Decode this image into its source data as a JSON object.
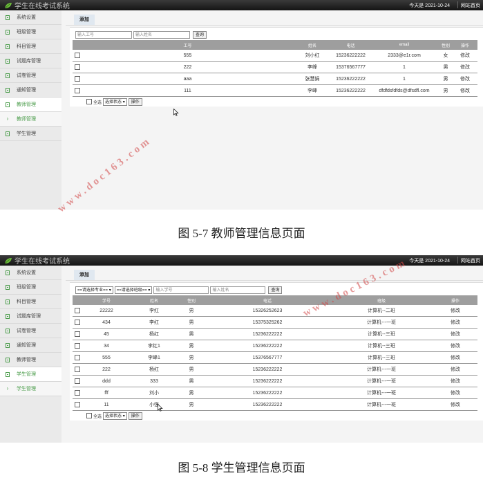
{
  "app_title": "学生在线考试系统",
  "date_text": "今天是 2021-10-24",
  "home_link": "网站首页",
  "tab_add": "添加",
  "colors": {
    "accent": "#4a9c4a",
    "header_bg": "#9e9e9e",
    "topbar": "#1e1e1e"
  },
  "screen1": {
    "sidebar": [
      {
        "label": "系统设置",
        "icon": "document-icon"
      },
      {
        "label": "班级管理",
        "icon": "document-icon"
      },
      {
        "label": "科目管理",
        "icon": "document-icon"
      },
      {
        "label": "试题库管理",
        "icon": "document-icon"
      },
      {
        "label": "试卷管理",
        "icon": "document-icon"
      },
      {
        "label": "通知管理",
        "icon": "document-icon"
      },
      {
        "label": "教师管理",
        "icon": "document-icon"
      },
      {
        "label": "教师管理",
        "icon": "chevron-right-icon"
      },
      {
        "label": "学生管理",
        "icon": "document-icon"
      }
    ],
    "search": {
      "id_placeholder": "输入工号",
      "name_placeholder": "输入姓名",
      "button": "查询"
    },
    "headers": [
      "",
      "工号",
      "姓名",
      "电话",
      "email",
      "性别",
      "操作"
    ],
    "rows": [
      {
        "id": "555",
        "name": "刘小红",
        "phone": "15236222222",
        "email": "2333@e1r.com",
        "gender": "女",
        "action": "修改"
      },
      {
        "id": "222",
        "name": "李峰",
        "phone": "15376567777",
        "email": "1",
        "gender": "男",
        "action": "修改"
      },
      {
        "id": "aaa",
        "name": "张慧娟",
        "phone": "15236222222",
        "email": "1",
        "gender": "男",
        "action": "修改"
      },
      {
        "id": "111",
        "name": "李峰",
        "phone": "15236222222",
        "email": "dfdfdsfdfds@dfsdfl.com",
        "gender": "男",
        "action": "修改"
      }
    ],
    "footer": {
      "select_all": "全选",
      "status_select": "选择状态",
      "operate": "操作"
    }
  },
  "caption1": "图 5-7 教师管理信息页面",
  "screen2": {
    "sidebar": [
      {
        "label": "系统设置",
        "icon": "document-icon"
      },
      {
        "label": "班级管理",
        "icon": "document-icon"
      },
      {
        "label": "科目管理",
        "icon": "document-icon"
      },
      {
        "label": "试题库管理",
        "icon": "document-icon"
      },
      {
        "label": "试卷管理",
        "icon": "document-icon"
      },
      {
        "label": "通知管理",
        "icon": "document-icon"
      },
      {
        "label": "教师管理",
        "icon": "document-icon"
      },
      {
        "label": "学生管理",
        "icon": "document-icon"
      },
      {
        "label": "学生管理",
        "icon": "chevron-right-icon"
      }
    ],
    "search": {
      "major_select": "==请选择专业==",
      "class_select": "==请选择班级==",
      "id_placeholder": "输入学号",
      "name_placeholder": "输入姓名",
      "button": "查询"
    },
    "headers": [
      "",
      "学号",
      "姓名",
      "性别",
      "电话",
      "班级",
      "操作"
    ],
    "rows": [
      {
        "id": "22222",
        "name": "李红",
        "gender": "男",
        "phone": "15326252623",
        "class": "计算机--二班",
        "action": "修改"
      },
      {
        "id": "434",
        "name": "李红",
        "gender": "男",
        "phone": "15375325262",
        "class": "计算机---一班",
        "action": "修改"
      },
      {
        "id": "45",
        "name": "杨红",
        "gender": "男",
        "phone": "15236222222",
        "class": "计算机--三班",
        "action": "修改"
      },
      {
        "id": "34",
        "name": "李红1",
        "gender": "男",
        "phone": "15236222222",
        "class": "计算机--三班",
        "action": "修改"
      },
      {
        "id": "555",
        "name": "李峰1",
        "gender": "男",
        "phone": "15376567777",
        "class": "计算机--三班",
        "action": "修改"
      },
      {
        "id": "222",
        "name": "杨红",
        "gender": "男",
        "phone": "15236222222",
        "class": "计算机---一班",
        "action": "修改"
      },
      {
        "id": "ddd",
        "name": "333",
        "gender": "男",
        "phone": "15236222222",
        "class": "计算机---一班",
        "action": "修改"
      },
      {
        "id": "fff",
        "name": "刘小",
        "gender": "男",
        "phone": "15236222222",
        "class": "计算机---一班",
        "action": "修改"
      },
      {
        "id": "11",
        "name": "小强",
        "gender": "男",
        "phone": "15236222222",
        "class": "计算机---一班",
        "action": "修改"
      }
    ],
    "footer": {
      "select_all": "全选",
      "status_select": "选择状态",
      "operate": "操作"
    }
  },
  "caption2": "图 5-8 学生管理信息页面",
  "watermark": "www.doc163.com"
}
